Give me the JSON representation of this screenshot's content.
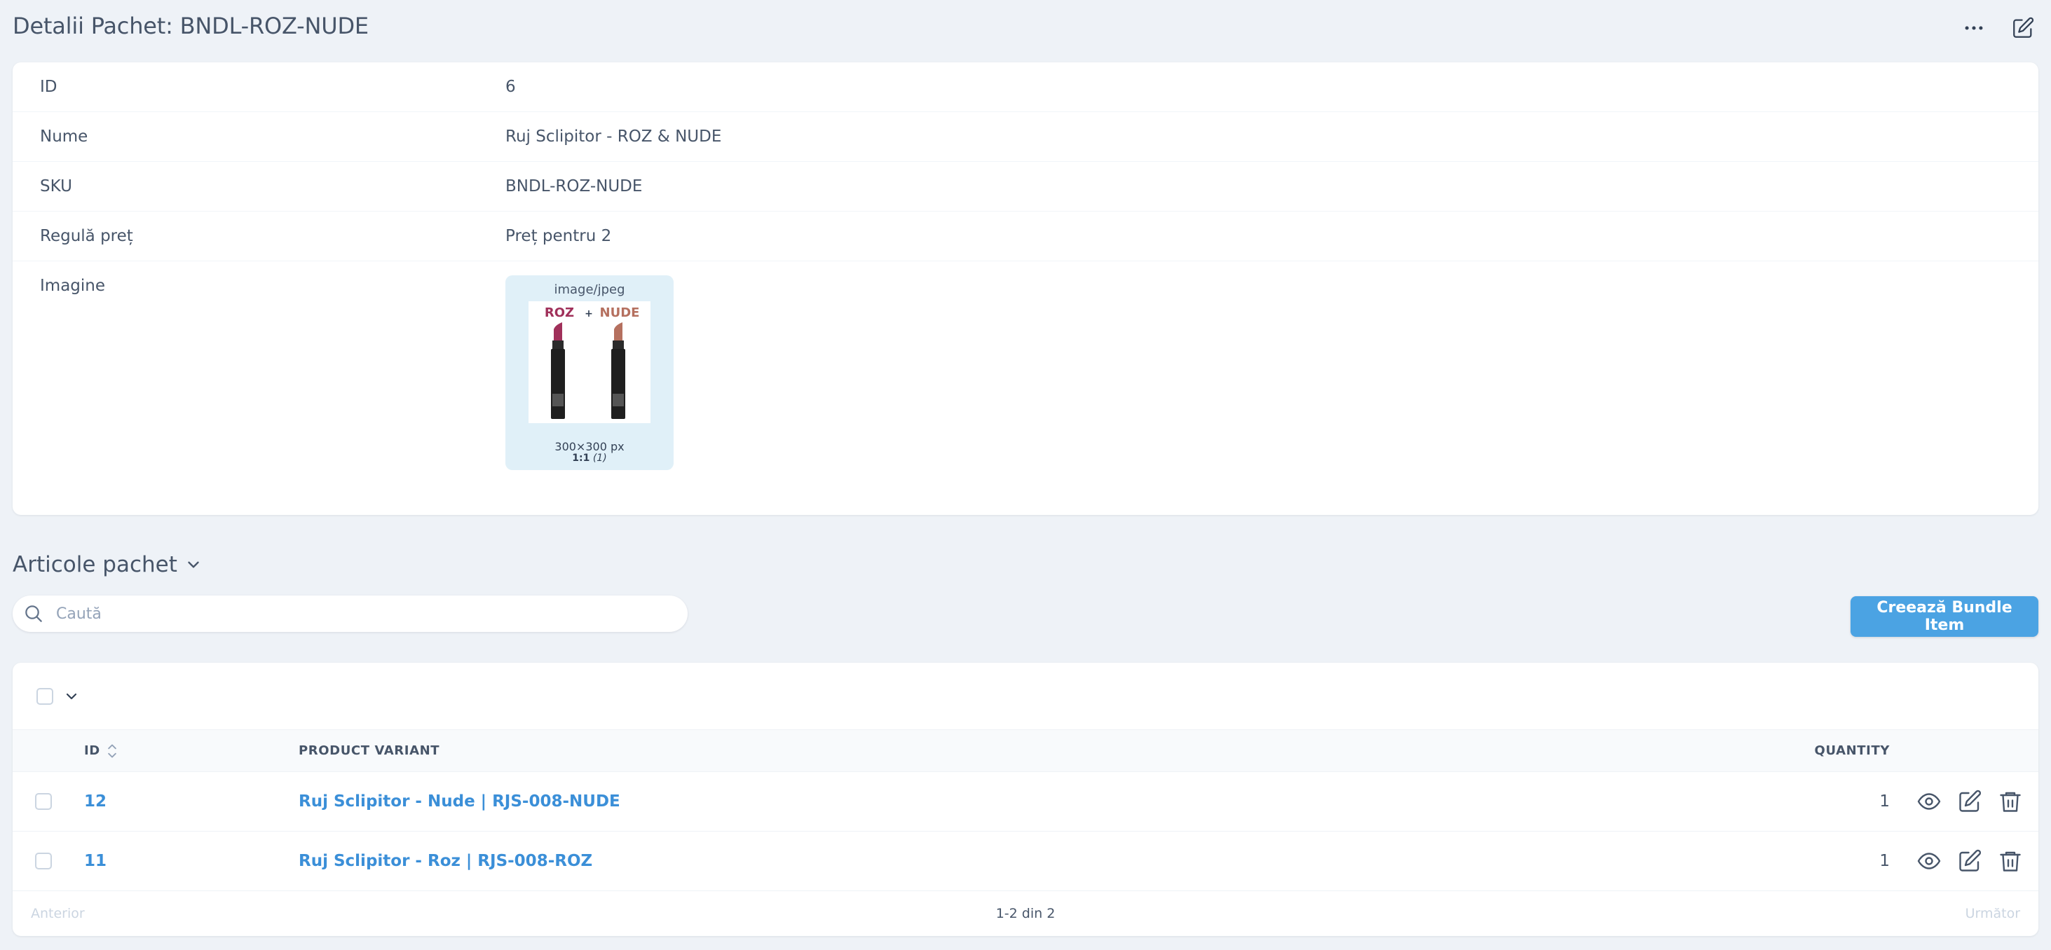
{
  "header": {
    "title": "Detalii Pachet: BNDL-ROZ-NUDE"
  },
  "details": [
    {
      "label": "ID",
      "value": "6"
    },
    {
      "label": "Nume",
      "value": "Ruj Sclipitor - ROZ & NUDE"
    },
    {
      "label": "SKU",
      "value": "BNDL-ROZ-NUDE"
    },
    {
      "label": "Regulă preț",
      "value": "Preț pentru 2"
    },
    {
      "label": "Imagine",
      "value": ""
    }
  ],
  "image": {
    "mime": "image/jpeg",
    "dims": "300×300 px",
    "ratio_bold": "1:1",
    "ratio_paren": "(1)",
    "left_text": "ROZ",
    "plus": "+",
    "right_text": "NUDE",
    "left_color": "#a0305a",
    "right_color": "#b5705f"
  },
  "bundle_items": {
    "title": "Articole pachet",
    "search_placeholder": "Caută",
    "create_label": "Creează Bundle Item",
    "columns": {
      "id": "ID",
      "product_variant": "PRODUCT VARIANT",
      "quantity": "QUANTITY"
    },
    "rows": [
      {
        "id": "12",
        "product_variant": "Ruj Sclipitor - Nude | RJS-008-NUDE",
        "quantity": "1"
      },
      {
        "id": "11",
        "product_variant": "Ruj Sclipitor - Roz | RJS-008-ROZ",
        "quantity": "1"
      }
    ],
    "pagination": {
      "prev": "Anterior",
      "info": "1-2 din 2",
      "next": "Următor"
    }
  },
  "colors": {
    "accent": "#4ba3e3",
    "link": "#3b8fd8",
    "background": "#eef2f7"
  }
}
